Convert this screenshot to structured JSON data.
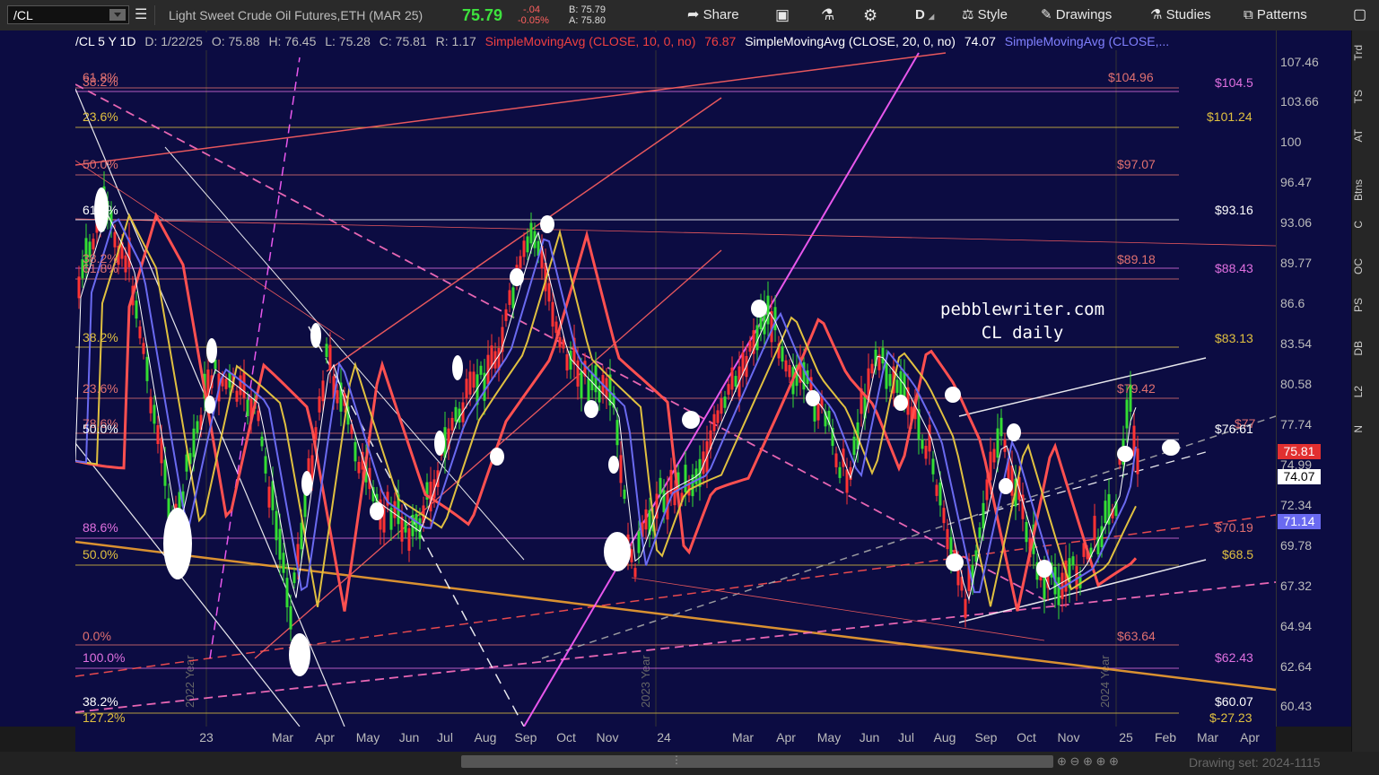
{
  "toolbar": {
    "symbol": "/CL",
    "description": "Light Sweet Crude Oil Futures,ETH (MAR 25)",
    "last": "75.79",
    "change": "-.04",
    "change_pct": "-0.05%",
    "bid": "B: 75.79",
    "ask": "A: 75.80",
    "share_label": "Share",
    "period_label": "D",
    "style_label": "Style",
    "drawings_label": "Drawings",
    "studies_label": "Studies",
    "patterns_label": "Patterns",
    "icons": [
      "share-icon",
      "save-icon",
      "flask-icon",
      "gear-icon",
      "style-icon",
      "pencil-icon",
      "flask-icon",
      "patterns-icon",
      "window-icon"
    ]
  },
  "header": {
    "symbol_period": "/CL 5 Y 1D",
    "date": "D: 1/22/25",
    "open": "O: 75.88",
    "high": "H: 76.45",
    "low": "L: 75.28",
    "close": "C: 75.81",
    "range": "R: 1.17",
    "sma10": "SimpleMovingAvg (CLOSE, 10, 0, no)",
    "sma10_val": "76.87",
    "sma20": "SimpleMovingAvg (CLOSE, 20, 0, no)",
    "sma20_val": "74.07",
    "sma3": "SimpleMovingAvg (CLOSE,..."
  },
  "watermark": {
    "line1": "pebblewriter.com",
    "line2": "CL daily"
  },
  "y_axis": [
    "107.46",
    "103.66",
    "100",
    "96.47",
    "93.06",
    "89.77",
    "86.6",
    "83.54",
    "80.58",
    "77.74",
    "74.99",
    "72.34",
    "69.78",
    "67.32",
    "64.94",
    "62.64",
    "60.43"
  ],
  "x_axis": [
    "23",
    "Mar",
    "Apr",
    "May",
    "Jun",
    "Jul",
    "Aug",
    "Sep",
    "Oct",
    "Nov",
    "24",
    "Mar",
    "Apr",
    "May",
    "Jun",
    "Jul",
    "Aug",
    "Sep",
    "Oct",
    "Nov",
    "25",
    "Feb",
    "Mar",
    "Apr"
  ],
  "year_labels": [
    "2022 Year",
    "2023 Year",
    "2024 Year"
  ],
  "price_tags": [
    {
      "value": "75.81",
      "color": "#e23030",
      "text_color": "#ffffff"
    },
    {
      "value": "74.07",
      "color": "#ffffff",
      "text_color": "#000000"
    },
    {
      "value": "71.14",
      "color": "#6a6af0",
      "text_color": "#ffffff"
    }
  ],
  "left_fib": [
    {
      "label": "61.8%",
      "color": "#e07070"
    },
    {
      "label": "38.2%",
      "color": "#e07070"
    },
    {
      "label": "23.6%",
      "color": "#e0c040"
    },
    {
      "label": "50.0%",
      "color": "#e07070"
    },
    {
      "label": "61.8%",
      "color": "#ffffff"
    },
    {
      "label": "38.2%",
      "color": "#e07070"
    },
    {
      "label": "61.8%",
      "color": "#e07070"
    },
    {
      "label": "38.2%",
      "color": "#e0c040"
    },
    {
      "label": "23.6%",
      "color": "#e07070"
    },
    {
      "label": "78.6%",
      "color": "#e07070"
    },
    {
      "label": "50.0%",
      "color": "#ffffff"
    },
    {
      "label": "88.6%",
      "color": "#e070e0"
    },
    {
      "label": "50.0%",
      "color": "#e0c040"
    },
    {
      "label": "0.0%",
      "color": "#e07070"
    },
    {
      "label": "100.0%",
      "color": "#e070e0"
    },
    {
      "label": "38.2%",
      "color": "#ffffff"
    },
    {
      "label": "127.2%",
      "color": "#e0c040"
    }
  ],
  "right_levels": [
    {
      "label": "$104.96",
      "color": "#e07070"
    },
    {
      "label": "$104.5",
      "color": "#e070e0"
    },
    {
      "label": "$101.24",
      "color": "#e0c040"
    },
    {
      "label": "$97.07",
      "color": "#e07070"
    },
    {
      "label": "$93.16",
      "color": "#ffffff"
    },
    {
      "label": "$89.18",
      "color": "#e07070"
    },
    {
      "label": "$88.43",
      "color": "#e070e0"
    },
    {
      "label": "$83.13",
      "color": "#e0c040"
    },
    {
      "label": "$79.42",
      "color": "#e07070"
    },
    {
      "label": "$77",
      "color": "#e07070"
    },
    {
      "label": "$76.61",
      "color": "#ffffff"
    },
    {
      "label": "$70.19",
      "color": "#e07070"
    },
    {
      "label": "$68.5",
      "color": "#e0c040"
    },
    {
      "label": "$63.64",
      "color": "#e07070"
    },
    {
      "label": "$62.43",
      "color": "#e070e0"
    },
    {
      "label": "$60.07",
      "color": "#ffffff"
    },
    {
      "label": "$-27.23",
      "color": "#e0c040"
    }
  ],
  "sidebar_tabs": [
    "Trd",
    "TS",
    "AT",
    "Btns",
    "C",
    "OC",
    "PS",
    "DB",
    "L2",
    "N"
  ],
  "footer": {
    "drawing_set": "Drawing set: 2024-1115"
  }
}
